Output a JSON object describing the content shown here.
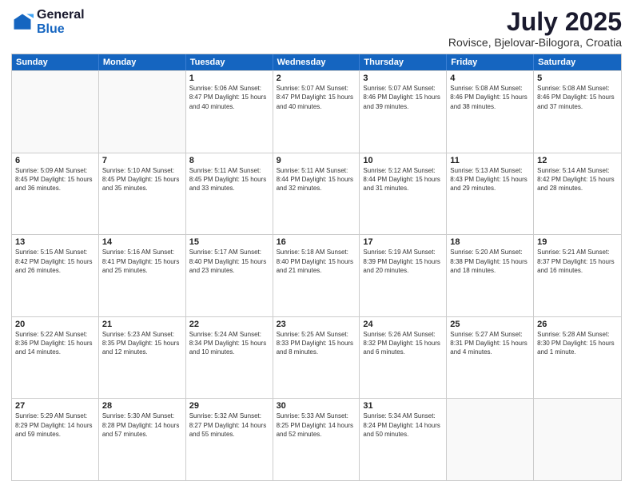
{
  "logo": {
    "general": "General",
    "blue": "Blue"
  },
  "title": "July 2025",
  "subtitle": "Rovisce, Bjelovar-Bilogora, Croatia",
  "headers": [
    "Sunday",
    "Monday",
    "Tuesday",
    "Wednesday",
    "Thursday",
    "Friday",
    "Saturday"
  ],
  "weeks": [
    [
      {
        "day": "",
        "info": ""
      },
      {
        "day": "",
        "info": ""
      },
      {
        "day": "1",
        "info": "Sunrise: 5:06 AM\nSunset: 8:47 PM\nDaylight: 15 hours and 40 minutes."
      },
      {
        "day": "2",
        "info": "Sunrise: 5:07 AM\nSunset: 8:47 PM\nDaylight: 15 hours and 40 minutes."
      },
      {
        "day": "3",
        "info": "Sunrise: 5:07 AM\nSunset: 8:46 PM\nDaylight: 15 hours and 39 minutes."
      },
      {
        "day": "4",
        "info": "Sunrise: 5:08 AM\nSunset: 8:46 PM\nDaylight: 15 hours and 38 minutes."
      },
      {
        "day": "5",
        "info": "Sunrise: 5:08 AM\nSunset: 8:46 PM\nDaylight: 15 hours and 37 minutes."
      }
    ],
    [
      {
        "day": "6",
        "info": "Sunrise: 5:09 AM\nSunset: 8:45 PM\nDaylight: 15 hours and 36 minutes."
      },
      {
        "day": "7",
        "info": "Sunrise: 5:10 AM\nSunset: 8:45 PM\nDaylight: 15 hours and 35 minutes."
      },
      {
        "day": "8",
        "info": "Sunrise: 5:11 AM\nSunset: 8:45 PM\nDaylight: 15 hours and 33 minutes."
      },
      {
        "day": "9",
        "info": "Sunrise: 5:11 AM\nSunset: 8:44 PM\nDaylight: 15 hours and 32 minutes."
      },
      {
        "day": "10",
        "info": "Sunrise: 5:12 AM\nSunset: 8:44 PM\nDaylight: 15 hours and 31 minutes."
      },
      {
        "day": "11",
        "info": "Sunrise: 5:13 AM\nSunset: 8:43 PM\nDaylight: 15 hours and 29 minutes."
      },
      {
        "day": "12",
        "info": "Sunrise: 5:14 AM\nSunset: 8:42 PM\nDaylight: 15 hours and 28 minutes."
      }
    ],
    [
      {
        "day": "13",
        "info": "Sunrise: 5:15 AM\nSunset: 8:42 PM\nDaylight: 15 hours and 26 minutes."
      },
      {
        "day": "14",
        "info": "Sunrise: 5:16 AM\nSunset: 8:41 PM\nDaylight: 15 hours and 25 minutes."
      },
      {
        "day": "15",
        "info": "Sunrise: 5:17 AM\nSunset: 8:40 PM\nDaylight: 15 hours and 23 minutes."
      },
      {
        "day": "16",
        "info": "Sunrise: 5:18 AM\nSunset: 8:40 PM\nDaylight: 15 hours and 21 minutes."
      },
      {
        "day": "17",
        "info": "Sunrise: 5:19 AM\nSunset: 8:39 PM\nDaylight: 15 hours and 20 minutes."
      },
      {
        "day": "18",
        "info": "Sunrise: 5:20 AM\nSunset: 8:38 PM\nDaylight: 15 hours and 18 minutes."
      },
      {
        "day": "19",
        "info": "Sunrise: 5:21 AM\nSunset: 8:37 PM\nDaylight: 15 hours and 16 minutes."
      }
    ],
    [
      {
        "day": "20",
        "info": "Sunrise: 5:22 AM\nSunset: 8:36 PM\nDaylight: 15 hours and 14 minutes."
      },
      {
        "day": "21",
        "info": "Sunrise: 5:23 AM\nSunset: 8:35 PM\nDaylight: 15 hours and 12 minutes."
      },
      {
        "day": "22",
        "info": "Sunrise: 5:24 AM\nSunset: 8:34 PM\nDaylight: 15 hours and 10 minutes."
      },
      {
        "day": "23",
        "info": "Sunrise: 5:25 AM\nSunset: 8:33 PM\nDaylight: 15 hours and 8 minutes."
      },
      {
        "day": "24",
        "info": "Sunrise: 5:26 AM\nSunset: 8:32 PM\nDaylight: 15 hours and 6 minutes."
      },
      {
        "day": "25",
        "info": "Sunrise: 5:27 AM\nSunset: 8:31 PM\nDaylight: 15 hours and 4 minutes."
      },
      {
        "day": "26",
        "info": "Sunrise: 5:28 AM\nSunset: 8:30 PM\nDaylight: 15 hours and 1 minute."
      }
    ],
    [
      {
        "day": "27",
        "info": "Sunrise: 5:29 AM\nSunset: 8:29 PM\nDaylight: 14 hours and 59 minutes."
      },
      {
        "day": "28",
        "info": "Sunrise: 5:30 AM\nSunset: 8:28 PM\nDaylight: 14 hours and 57 minutes."
      },
      {
        "day": "29",
        "info": "Sunrise: 5:32 AM\nSunset: 8:27 PM\nDaylight: 14 hours and 55 minutes."
      },
      {
        "day": "30",
        "info": "Sunrise: 5:33 AM\nSunset: 8:25 PM\nDaylight: 14 hours and 52 minutes."
      },
      {
        "day": "31",
        "info": "Sunrise: 5:34 AM\nSunset: 8:24 PM\nDaylight: 14 hours and 50 minutes."
      },
      {
        "day": "",
        "info": ""
      },
      {
        "day": "",
        "info": ""
      }
    ]
  ]
}
